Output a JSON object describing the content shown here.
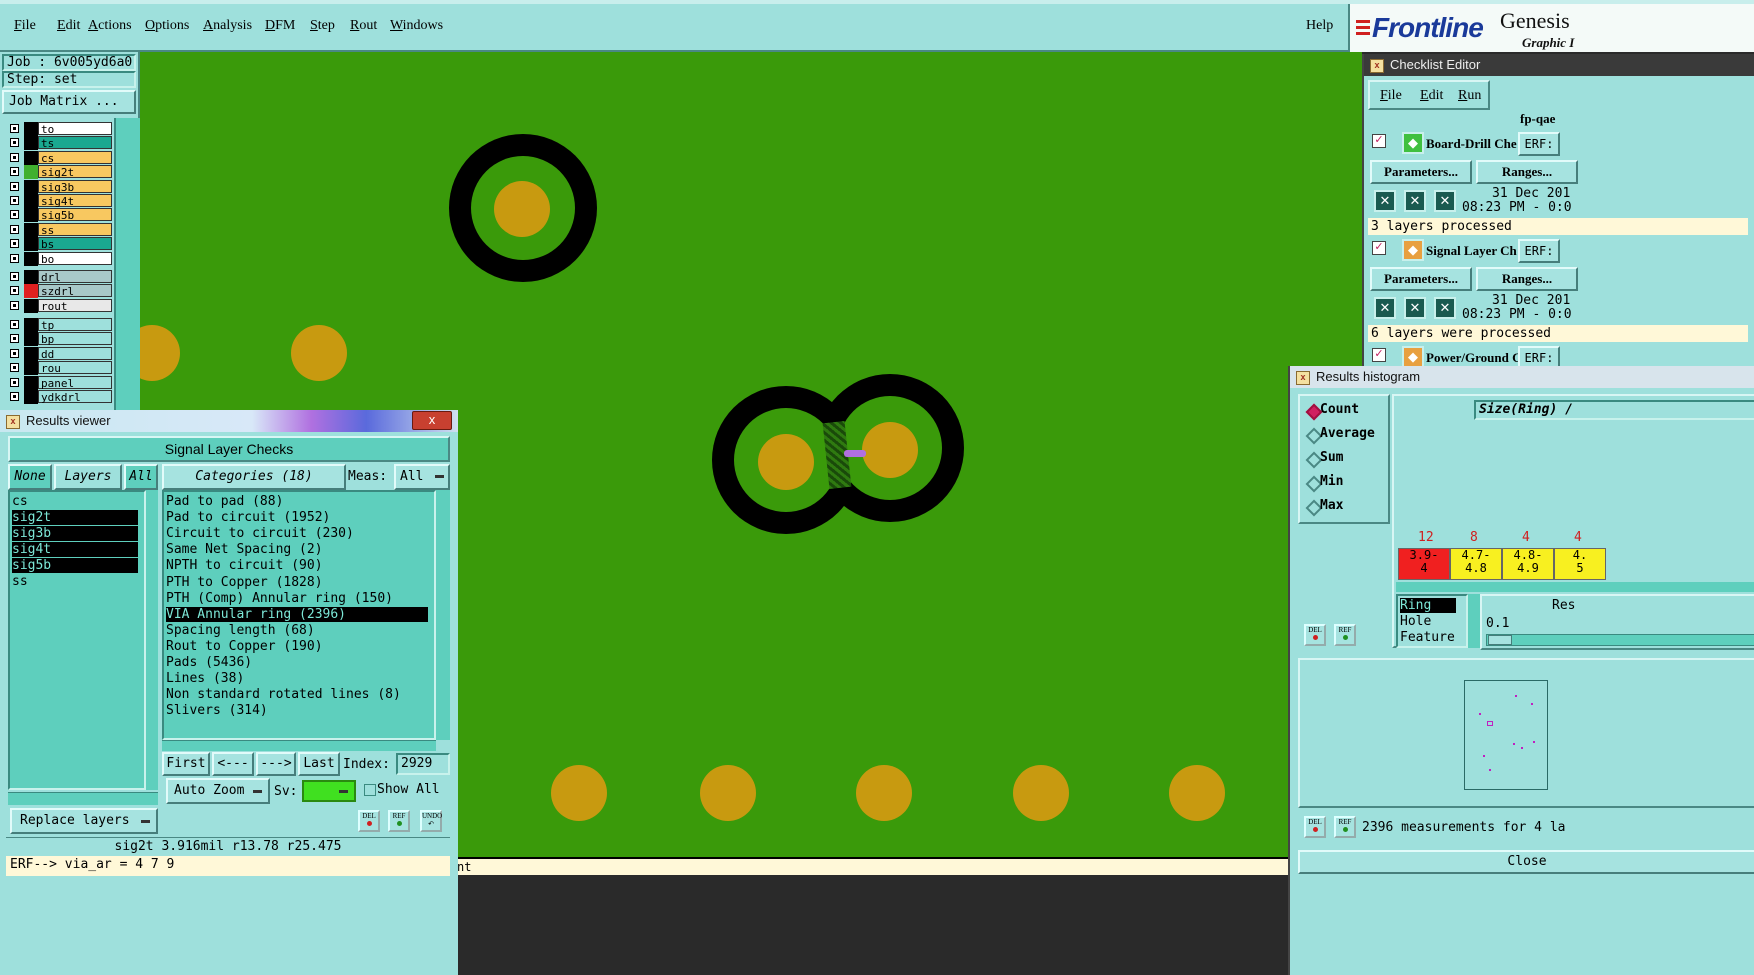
{
  "menubar": {
    "items": [
      "File",
      "Edit",
      "Actions",
      "Options",
      "Analysis",
      "DFM",
      "Step",
      "Rout",
      "Windows"
    ],
    "help": "Help",
    "brand": "Frontline",
    "product": "Genesis",
    "product_sub": "Graphic I"
  },
  "left_panel": {
    "job": "Job : 6v005yd6a0",
    "step": "Step: set",
    "job_matrix": "Job Matrix ...",
    "layers_group1": [
      {
        "name": "to",
        "bg": "#ffffff",
        "swatch": "#000000"
      },
      {
        "name": "ts",
        "bg": "#1aa890",
        "swatch": "#000000"
      },
      {
        "name": "cs",
        "bg": "#f8c860",
        "swatch": "#000000"
      },
      {
        "name": "sig2t",
        "bg": "#f8c860",
        "swatch": "#40b030"
      },
      {
        "name": "sig3b",
        "bg": "#f8c860",
        "swatch": "#000000"
      },
      {
        "name": "sig4t",
        "bg": "#f8c860",
        "swatch": "#000000"
      },
      {
        "name": "sig5b",
        "bg": "#f8c860",
        "swatch": "#000000"
      },
      {
        "name": "ss",
        "bg": "#f8c860",
        "swatch": "#000000"
      },
      {
        "name": "bs",
        "bg": "#1aa890",
        "swatch": "#000000"
      },
      {
        "name": "bo",
        "bg": "#ffffff",
        "swatch": "#000000"
      }
    ],
    "layers_group2": [
      {
        "name": "drl",
        "bg": "#a8c8c8",
        "swatch": "#000000"
      },
      {
        "name": "szdrl",
        "bg": "#a8c8c8",
        "swatch": "#e02020"
      },
      {
        "name": "rout",
        "bg": "#e8e8e8",
        "swatch": "#000000"
      }
    ],
    "layers_group3": [
      {
        "name": "tp",
        "bg": "#9ee0dc",
        "swatch": "#000000"
      },
      {
        "name": "bp",
        "bg": "#9ee0dc",
        "swatch": "#000000"
      },
      {
        "name": "dd",
        "bg": "#9ee0dc",
        "swatch": "#000000"
      },
      {
        "name": "rou",
        "bg": "#9ee0dc",
        "swatch": "#000000"
      },
      {
        "name": "panel",
        "bg": "#9ee0dc",
        "swatch": "#000000"
      },
      {
        "name": "ydkdrl",
        "bg": "#9ee0dc",
        "swatch": "#000000"
      }
    ]
  },
  "results_viewer": {
    "title": "Results viewer",
    "close": "x",
    "heading": "Signal Layer Checks",
    "none_btn": "None",
    "layers_btn": "Layers",
    "all_btn": "All",
    "layers": [
      {
        "name": "cs",
        "selected": false
      },
      {
        "name": "sig2t",
        "selected": true
      },
      {
        "name": "sig3b",
        "selected": true
      },
      {
        "name": "sig4t",
        "selected": true
      },
      {
        "name": "sig5b",
        "selected": true
      },
      {
        "name": "ss",
        "selected": false
      }
    ],
    "categories_btn": "Categories (18)",
    "meas_label": "Meas:",
    "meas_value": "All",
    "categories": [
      {
        "label": "Pad to pad (88)",
        "selected": false
      },
      {
        "label": "Pad to circuit (1952)",
        "selected": false
      },
      {
        "label": "Circuit to circuit (230)",
        "selected": false
      },
      {
        "label": "Same Net Spacing (2)",
        "selected": false
      },
      {
        "label": "NPTH to circuit (90)",
        "selected": false
      },
      {
        "label": "PTH to Copper (1828)",
        "selected": false
      },
      {
        "label": "PTH (Comp) Annular ring (150)",
        "selected": false
      },
      {
        "label": "VIA Annular ring (2396)",
        "selected": true
      },
      {
        "label": "Spacing length (68)",
        "selected": false
      },
      {
        "label": "Rout to Copper (190)",
        "selected": false
      },
      {
        "label": "Pads (5436)",
        "selected": false
      },
      {
        "label": "Lines (38)",
        "selected": false
      },
      {
        "label": "Non standard rotated lines (8)",
        "selected": false
      },
      {
        "label": "Slivers (314)",
        "selected": false
      }
    ],
    "first": "First",
    "prev": "<---",
    "next": "--->",
    "last": "Last",
    "index_label": "Index:",
    "index_value": "2929",
    "auto_zoom": "Auto Zoom",
    "sv_label": "Sv:",
    "show_all": "Show All",
    "replace_layers": "Replace layers",
    "del": "DEL",
    "ref": "REF",
    "undo": "UNDO",
    "status": "sig2t 3.916mil  r13.78  r25.475",
    "erf": "ERF--> via_ar = 4 7 9"
  },
  "bottom_strip": "nt",
  "checklist": {
    "title": "Checklist Editor",
    "menu": [
      "File",
      "Edit",
      "Run"
    ],
    "name": "fp-qae",
    "checks": [
      {
        "label": "Board-Drill Che",
        "erf": "ERF:",
        "params": "Parameters...",
        "ranges": "Ranges...",
        "date": "31 Dec 201",
        "time": "08:23 PM - 0:0",
        "status": "3 layers processed"
      },
      {
        "label": "Signal Layer Ch",
        "erf": "ERF:",
        "params": "Parameters...",
        "ranges": "Ranges...",
        "date": "31 Dec 201",
        "time": "08:23 PM - 0:0",
        "status": "6 layers were processed"
      },
      {
        "label": "Power/Ground C",
        "erf": "ERF:"
      }
    ]
  },
  "histogram": {
    "title": "Results histogram",
    "modes": [
      {
        "label": "Count",
        "selected": true
      },
      {
        "label": "Average",
        "selected": false
      },
      {
        "label": "Sum",
        "selected": false
      },
      {
        "label": "Min",
        "selected": false
      },
      {
        "label": "Max",
        "selected": false
      }
    ],
    "size_label": "Size(Ring) /",
    "bins": [
      {
        "count": "12",
        "range": "3.9-\n4",
        "color": "#f02020"
      },
      {
        "count": "8",
        "range": "4.7-\n4.8",
        "color": "#f8f020"
      },
      {
        "count": "4",
        "range": "4.8-\n4.9",
        "color": "#f8f020"
      },
      {
        "count": "4",
        "range": "4.\n5",
        "color": "#f8f020"
      }
    ],
    "attrs": [
      {
        "label": "Ring",
        "selected": true
      },
      {
        "label": "Hole",
        "selected": false
      },
      {
        "label": "Feature",
        "selected": false
      }
    ],
    "res_label": "Res",
    "res_value": "0.1",
    "del": "DEL",
    "ref": "REF",
    "measurements": "2396 measurements for 4 la",
    "close": "Close"
  },
  "colors": {
    "canvas": "#3a9a0a",
    "pad": "#c89a10",
    "panel": "#9ee0dc",
    "list_bg": "#5ecfbd"
  }
}
